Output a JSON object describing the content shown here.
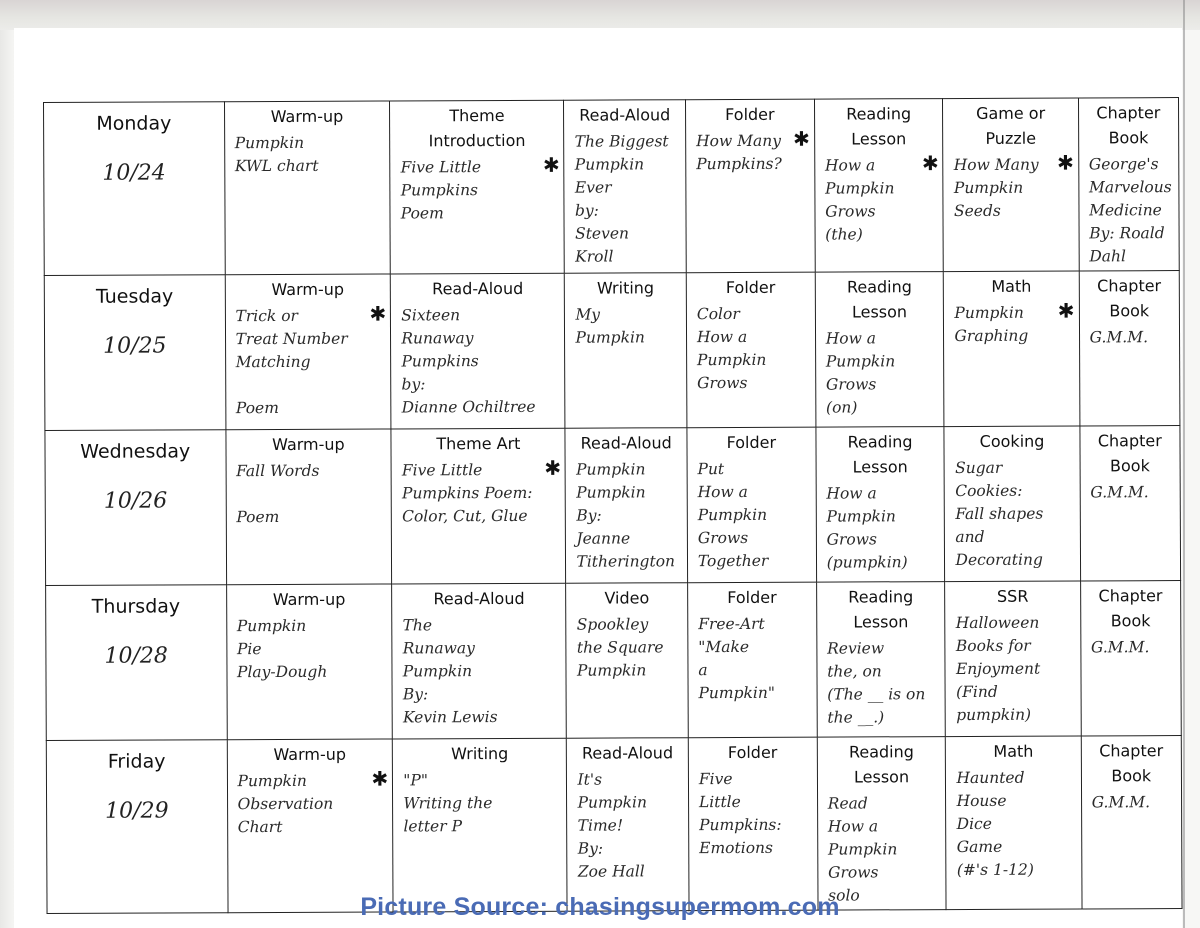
{
  "document": {
    "type": "weekly lesson plan (scanned handwritten grid)",
    "star_marker": "✱"
  },
  "caption": "Picture Source: chasingsupermom.com",
  "colors": {
    "caption": "#4a6bb5",
    "grid_lines": "#222222"
  },
  "rows": [
    {
      "day": "Monday",
      "date": "10/24",
      "cells": [
        {
          "subject": "Warm-up",
          "note": "Pumpkin\nKWL chart",
          "star": false
        },
        {
          "subject": "Theme\nIntroduction",
          "note": "Five Little\nPumpkins\nPoem",
          "star": true
        },
        {
          "subject": "Read-Aloud",
          "note": "The Biggest\nPumpkin Ever\nby:\nSteven\nKroll",
          "star": false
        },
        {
          "subject": "Folder",
          "note": "How Many\nPumpkins?",
          "star": true
        },
        {
          "subject": "Reading\nLesson",
          "note": "How a\nPumpkin\nGrows\n(the)",
          "star": true
        },
        {
          "subject": "Game or\nPuzzle",
          "note": "How Many\nPumpkin\nSeeds",
          "star": true
        },
        {
          "subject": "Chapter\nBook",
          "note": "George's\nMarvelous\nMedicine\nBy: Roald Dahl",
          "star": false
        }
      ]
    },
    {
      "day": "Tuesday",
      "date": "10/25",
      "cells": [
        {
          "subject": "Warm-up",
          "note": "Trick or\nTreat Number\nMatching\n\nPoem",
          "star": true
        },
        {
          "subject": "Read-Aloud",
          "note": "Sixteen\nRunaway\nPumpkins\nby:\nDianne Ochiltree",
          "star": false
        },
        {
          "subject": "Writing",
          "note": "My\nPumpkin",
          "star": false
        },
        {
          "subject": "Folder",
          "note": "Color\nHow a\nPumpkin\nGrows",
          "star": false
        },
        {
          "subject": "Reading\nLesson",
          "note": "How a\nPumpkin\nGrows\n(on)",
          "star": false
        },
        {
          "subject": "Math",
          "note": "Pumpkin\nGraphing",
          "star": true
        },
        {
          "subject": "Chapter\nBook",
          "note": "G.M.M.",
          "star": false
        }
      ]
    },
    {
      "day": "Wednesday",
      "date": "10/26",
      "cells": [
        {
          "subject": "Warm-up",
          "note": "Fall Words\n\nPoem",
          "star": false
        },
        {
          "subject": "Theme Art",
          "note": "Five Little\nPumpkins Poem:\nColor, Cut, Glue",
          "star": true
        },
        {
          "subject": "Read-Aloud",
          "note": "Pumpkin\nPumpkin\nBy:\nJeanne\nTitherington",
          "star": false
        },
        {
          "subject": "Folder",
          "note": "Put\nHow a\nPumpkin\nGrows\nTogether",
          "star": false
        },
        {
          "subject": "Reading\nLesson",
          "note": "How a\nPumpkin\nGrows\n(pumpkin)",
          "star": false
        },
        {
          "subject": "Cooking",
          "note": "Sugar\nCookies:\nFall shapes\nand\nDecorating",
          "star": false
        },
        {
          "subject": "Chapter\nBook",
          "note": "G.M.M.",
          "star": false
        }
      ]
    },
    {
      "day": "Thursday",
      "date": "10/28",
      "cells": [
        {
          "subject": "Warm-up",
          "note": "Pumpkin\nPie\nPlay-Dough",
          "star": false
        },
        {
          "subject": "Read-Aloud",
          "note": "The\nRunaway\nPumpkin\nBy:\nKevin Lewis",
          "star": false
        },
        {
          "subject": "Video",
          "note": "Spookley\nthe Square\nPumpkin",
          "star": false
        },
        {
          "subject": "Folder",
          "note": "Free-Art\n\"Make\na\nPumpkin\"",
          "star": false
        },
        {
          "subject": "Reading\nLesson",
          "note": "Review\nthe, on\n(The __ is on\nthe __.)",
          "star": false
        },
        {
          "subject": "SSR",
          "note": "Halloween\nBooks for\nEnjoyment\n(Find\npumpkin)",
          "star": false
        },
        {
          "subject": "Chapter\nBook",
          "note": "G.M.M.",
          "star": false
        }
      ]
    },
    {
      "day": "Friday",
      "date": "10/29",
      "cells": [
        {
          "subject": "Warm-up",
          "note": "Pumpkin\nObservation\nChart",
          "star": true
        },
        {
          "subject": "Writing",
          "note": "\"P\"\nWriting the\nletter P",
          "star": false
        },
        {
          "subject": "Read-Aloud",
          "note": "It's\nPumpkin\nTime!\nBy:\nZoe Hall",
          "star": false
        },
        {
          "subject": "Folder",
          "note": "Five\nLittle\nPumpkins:\nEmotions",
          "star": false
        },
        {
          "subject": "Reading\nLesson",
          "note": "Read\nHow a\nPumpkin\nGrows\nsolo",
          "star": false
        },
        {
          "subject": "Math",
          "note": "Haunted\nHouse\nDice\nGame\n(#'s 1-12)",
          "star": false
        },
        {
          "subject": "Chapter\nBook",
          "note": "G.M.M.",
          "star": false
        }
      ]
    }
  ]
}
